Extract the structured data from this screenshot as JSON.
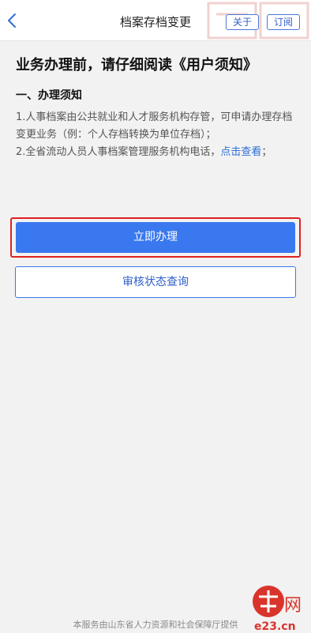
{
  "nav": {
    "title": "档案存档变更",
    "about_label": "关于",
    "subscribe_label": "订阅"
  },
  "main": {
    "heading": "业务办理前，请仔细阅读《用户须知》",
    "section_title": "一、办理须知",
    "notice_1": "1.人事档案由公共就业和人才服务机构存管，可申请办理存档变更业务（例：个人存档转换为单位存档）；",
    "notice_2_text": "2.全省流动人员人事档案管理服务机构电话，",
    "notice_2_link": "点击查看",
    "notice_2_end": "；"
  },
  "actions": {
    "apply_label": "立即办理",
    "status_label": "审核状态查询"
  },
  "footer": {
    "provider_text": "本服务由山东省人力资源和社会保障厅提供"
  },
  "watermark": {
    "text": "网",
    "site": "e23.cn"
  },
  "colors": {
    "primary": "#3a78ef",
    "highlight_border": "#e02020",
    "link": "#2f6fd6",
    "background": "#f2f2f2"
  }
}
